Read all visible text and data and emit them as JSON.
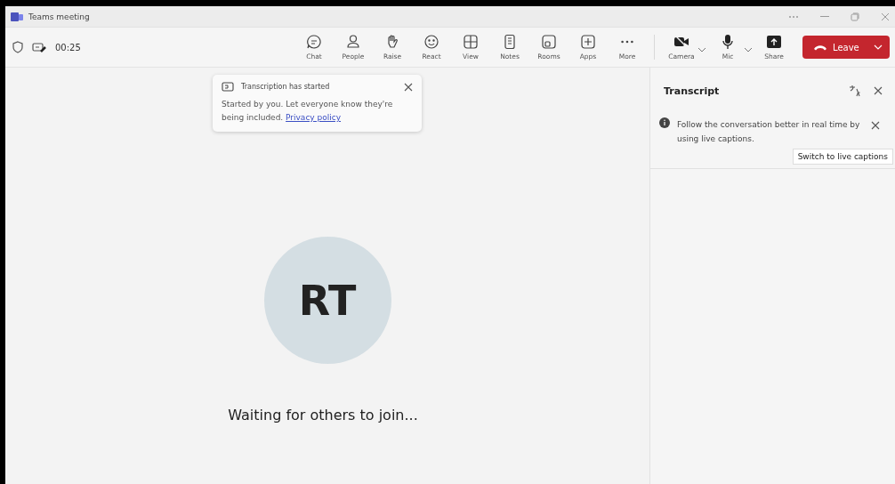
{
  "window": {
    "title": "Teams meeting"
  },
  "meeting": {
    "timer": "00:25"
  },
  "toolbar": [
    {
      "label": "Chat"
    },
    {
      "label": "People"
    },
    {
      "label": "Raise"
    },
    {
      "label": "React"
    },
    {
      "label": "View"
    },
    {
      "label": "Notes"
    },
    {
      "label": "Rooms"
    },
    {
      "label": "Apps"
    },
    {
      "label": "More"
    }
  ],
  "devices": [
    {
      "label": "Camera",
      "on": false
    },
    {
      "label": "Mic",
      "on": true
    }
  ],
  "share": {
    "label": "Share"
  },
  "leave": {
    "label": "Leave"
  },
  "toast": {
    "title": "Transcription has started",
    "body": "Started by you. Let everyone know they're being included.",
    "link": "Privacy policy"
  },
  "participant": {
    "initials": "RT",
    "status": "Waiting for others to join..."
  },
  "transcript": {
    "title": "Transcript",
    "notice": "Follow the conversation better in real time by using live captions.",
    "action": "Switch to live captions"
  }
}
